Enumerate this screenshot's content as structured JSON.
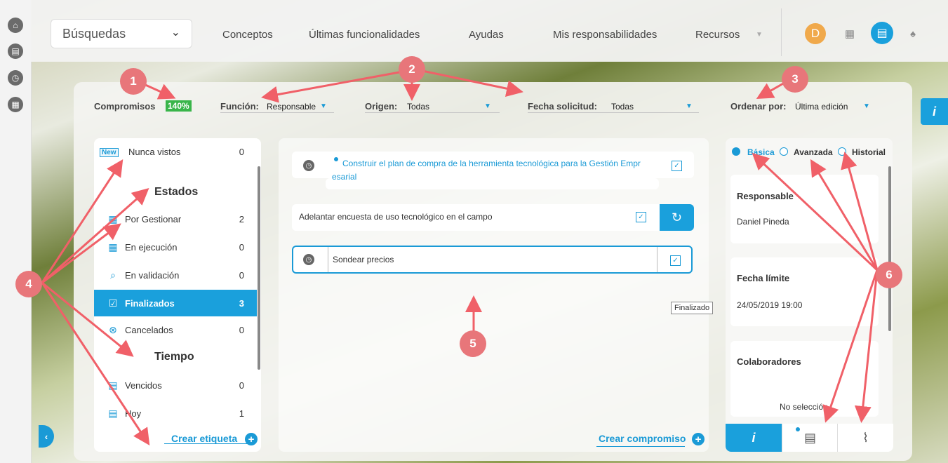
{
  "topbar": {
    "search_label": "Búsquedas",
    "nav": [
      "Conceptos",
      "Últimas funcionalidades",
      "Ayudas",
      "Mis responsabilidades",
      "Recursos"
    ],
    "avatar_initial": "D"
  },
  "filters": {
    "compromisos_label": "Compromisos",
    "compromisos_pct": "140%",
    "funcion_label": "Función:",
    "funcion_value": "Responsable",
    "origen_label": "Origen:",
    "origen_value": "Todas",
    "fecha_label": "Fecha solicitud:",
    "fecha_value": "Todas",
    "ordenar_label": "Ordenar por:",
    "ordenar_value": "Última edición"
  },
  "left": {
    "new_badge": "New",
    "nunca_vistos": {
      "label": "Nunca vistos",
      "count": "0"
    },
    "estados_title": "Estados",
    "estados": [
      {
        "label": "Por Gestionar",
        "count": "2"
      },
      {
        "label": "En ejecución",
        "count": "0"
      },
      {
        "label": "En validación",
        "count": "0"
      },
      {
        "label": "Finalizados",
        "count": "3"
      },
      {
        "label": "Cancelados",
        "count": "0"
      }
    ],
    "tiempo_title": "Tiempo",
    "tiempo": [
      {
        "label": "Vencidos",
        "count": "0"
      },
      {
        "label": "Hoy",
        "count": "1"
      }
    ],
    "crear_etiqueta": "Crear etiqueta"
  },
  "center": {
    "tasks": [
      {
        "title": "Construir el plan de compra de la herramienta tecnológica para la Gestión Empr",
        "title2": "esarial"
      },
      {
        "title": "Adelantar encuesta de uso tecnológico en el campo"
      },
      {
        "title": "Sondear precios"
      }
    ],
    "tooltip": "Finalizado",
    "crear_compromiso": "Crear compromiso"
  },
  "right": {
    "tabs": [
      "Básica",
      "Avanzada",
      "Historial"
    ],
    "responsable_title": "Responsable",
    "responsable_value": "Daniel Pineda",
    "fecha_limite_title": "Fecha límite",
    "fecha_limite_value": "24/05/2019 19:00",
    "colaboradores_title": "Colaboradores",
    "colaboradores_value": "No selección"
  },
  "markers": [
    "1",
    "2",
    "3",
    "4",
    "5",
    "6"
  ],
  "colors": {
    "accent": "#1a9ad6",
    "marker": "#e8767a",
    "percent": "#39b54a"
  }
}
